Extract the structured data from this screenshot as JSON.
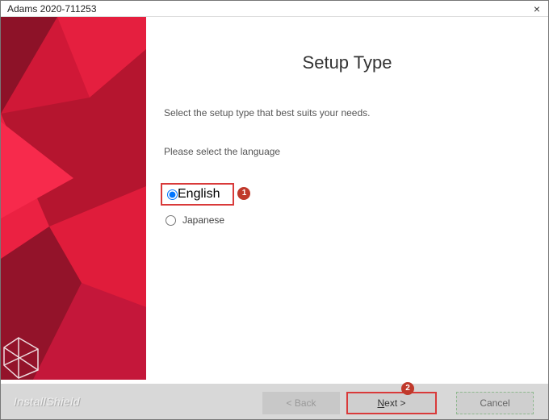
{
  "titlebar": {
    "title": "Adams 2020-711253",
    "close_glyph": "×"
  },
  "page": {
    "heading": "Setup Type",
    "description": "Select the setup type that best suits your needs.",
    "prompt": "Please select the language"
  },
  "options": {
    "english": {
      "label": "English",
      "checked": true
    },
    "japanese": {
      "label": "Japanese",
      "checked": false
    }
  },
  "annotations": {
    "badge1": "1",
    "badge2": "2"
  },
  "footer": {
    "brand": "InstallShield",
    "back": "< Back",
    "next_underline": "N",
    "next_rest": "ext >",
    "cancel": "Cancel"
  }
}
